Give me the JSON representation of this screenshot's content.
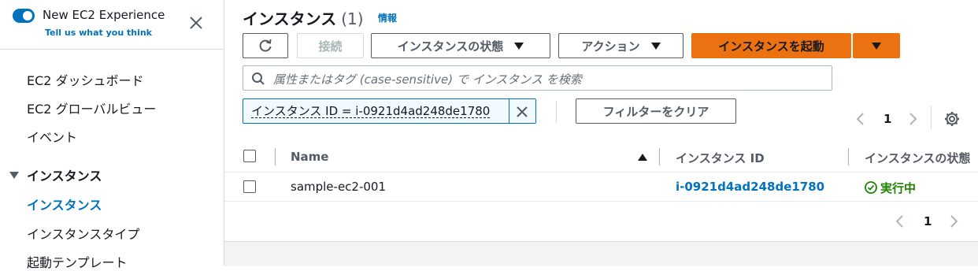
{
  "sidebar": {
    "experience_title": "New EC2 Experience",
    "experience_link": "Tell us what you think",
    "items": [
      {
        "label": "EC2 ダッシュボード"
      },
      {
        "label": "EC2 グローバルビュー"
      },
      {
        "label": "イベント"
      }
    ],
    "group_label": "インスタンス",
    "group_items": [
      {
        "label": "インスタンス",
        "active": true
      },
      {
        "label": "インスタンスタイプ"
      },
      {
        "label": "起動テンプレート"
      }
    ]
  },
  "header": {
    "title": "インスタンス",
    "count": "(1)",
    "info": "情報"
  },
  "toolbar": {
    "connect": "接続",
    "state": "インスタンスの状態",
    "actions": "アクション",
    "launch": "インスタンスを起動"
  },
  "search": {
    "placeholder": "属性またはタグ (case-sensitive) で インスタンス を検索"
  },
  "filter": {
    "token": "インスタンス ID = i-0921d4ad248de1780",
    "clear": "フィルターをクリア"
  },
  "pagination": {
    "page": "1"
  },
  "table": {
    "headers": [
      "Name",
      "インスタンス ID",
      "インスタンスの状態"
    ],
    "rows": [
      {
        "name": "sample-ec2-001",
        "instance_id": "i-0921d4ad248de1780",
        "state": "実行中"
      }
    ]
  },
  "colors": {
    "primary": "#ec7211",
    "link": "#0073bb",
    "success": "#1d8102"
  }
}
